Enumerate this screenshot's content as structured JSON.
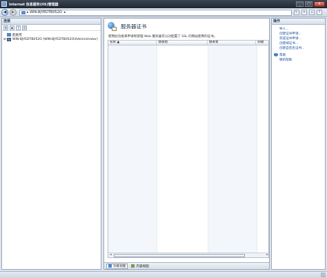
{
  "window": {
    "title": "Internet 信息服务(IIS)管理器",
    "buttons": {
      "minimize": "_",
      "maximize": "□",
      "close": "X"
    }
  },
  "addressbar": {
    "crumbs": [
      "WIN-BJYEDTB052O",
      "▸"
    ],
    "back_icon": "back-arrow-icon",
    "forward_icon": "forward-arrow-icon"
  },
  "connections": {
    "header": "连接",
    "tree": [
      {
        "expander": "",
        "label": "起始页",
        "icon": "home-icon"
      },
      {
        "expander": "⊞",
        "label": "WIN-BJYEDTB052O (WIN-BJYEDTB052O\\Administrator)",
        "icon": "server-icon"
      }
    ]
  },
  "content": {
    "title": "服务器证书",
    "description": "使用此功能来申请和管理 Web 服务器可以对配置了 SSL 的网站使用的证书。",
    "columns": [
      "名称 ▲",
      "颁发给",
      "颁发者",
      "到期"
    ],
    "tabs": {
      "features": "功能视图",
      "content": "内容视图"
    }
  },
  "actions": {
    "header": "操作",
    "items": [
      {
        "label": "导入...",
        "icon": "import-icon"
      },
      {
        "label": "创建证书申请...",
        "icon": ""
      },
      {
        "label": "完成证书申请...",
        "icon": ""
      },
      {
        "label": "创建域证书...",
        "icon": ""
      },
      {
        "label": "创建自签名证书...",
        "icon": ""
      }
    ],
    "help": [
      {
        "label": "帮助",
        "icon": "help-icon"
      },
      {
        "label": "联机帮助",
        "icon": ""
      }
    ]
  }
}
